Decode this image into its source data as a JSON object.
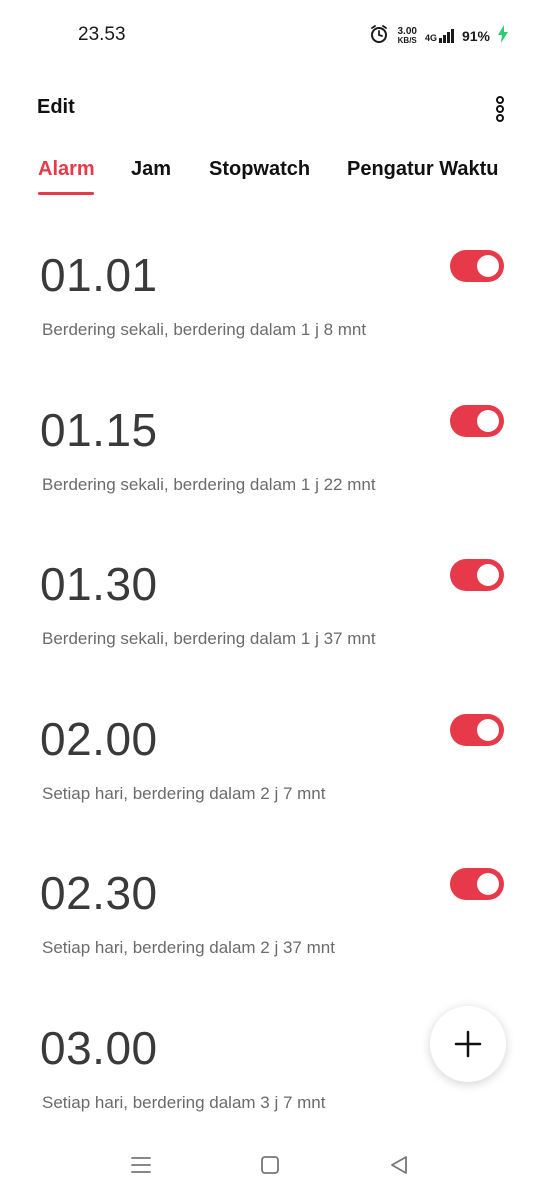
{
  "status_bar": {
    "time": "23.53",
    "speed_value": "3.00",
    "speed_unit": "KB/S",
    "network": "4G",
    "battery": "91%",
    "icons": [
      "alarm-icon",
      "signal-icon",
      "charging-icon"
    ]
  },
  "header": {
    "edit_label": "Edit",
    "menu_icon": "more-vertical-icon"
  },
  "tabs": [
    {
      "label": "Alarm",
      "active": true
    },
    {
      "label": "Jam",
      "active": false
    },
    {
      "label": "Stopwatch",
      "active": false
    },
    {
      "label": "Pengatur Waktu",
      "active": false
    }
  ],
  "alarms": [
    {
      "time": "01.01",
      "description": "Berdering sekali, berdering dalam 1 j 8 mnt",
      "enabled": true
    },
    {
      "time": "01.15",
      "description": "Berdering sekali, berdering dalam 1 j 22 mnt",
      "enabled": true
    },
    {
      "time": "01.30",
      "description": "Berdering sekali, berdering dalam 1 j 37 mnt",
      "enabled": true
    },
    {
      "time": "02.00",
      "description": "Setiap hari, berdering dalam 2 j 7 mnt",
      "enabled": true
    },
    {
      "time": "02.30",
      "description": "Setiap hari, berdering dalam 2 j 37 mnt",
      "enabled": true
    },
    {
      "time": "03.00",
      "description": "Setiap hari, berdering dalam 3 j 7 mnt",
      "enabled": true
    }
  ],
  "fab": {
    "icon": "plus-icon"
  },
  "nav": {
    "icons": [
      "menu-icon",
      "home-icon",
      "back-icon"
    ]
  },
  "colors": {
    "accent": "#e63a4b",
    "charging": "#2ecc71"
  }
}
